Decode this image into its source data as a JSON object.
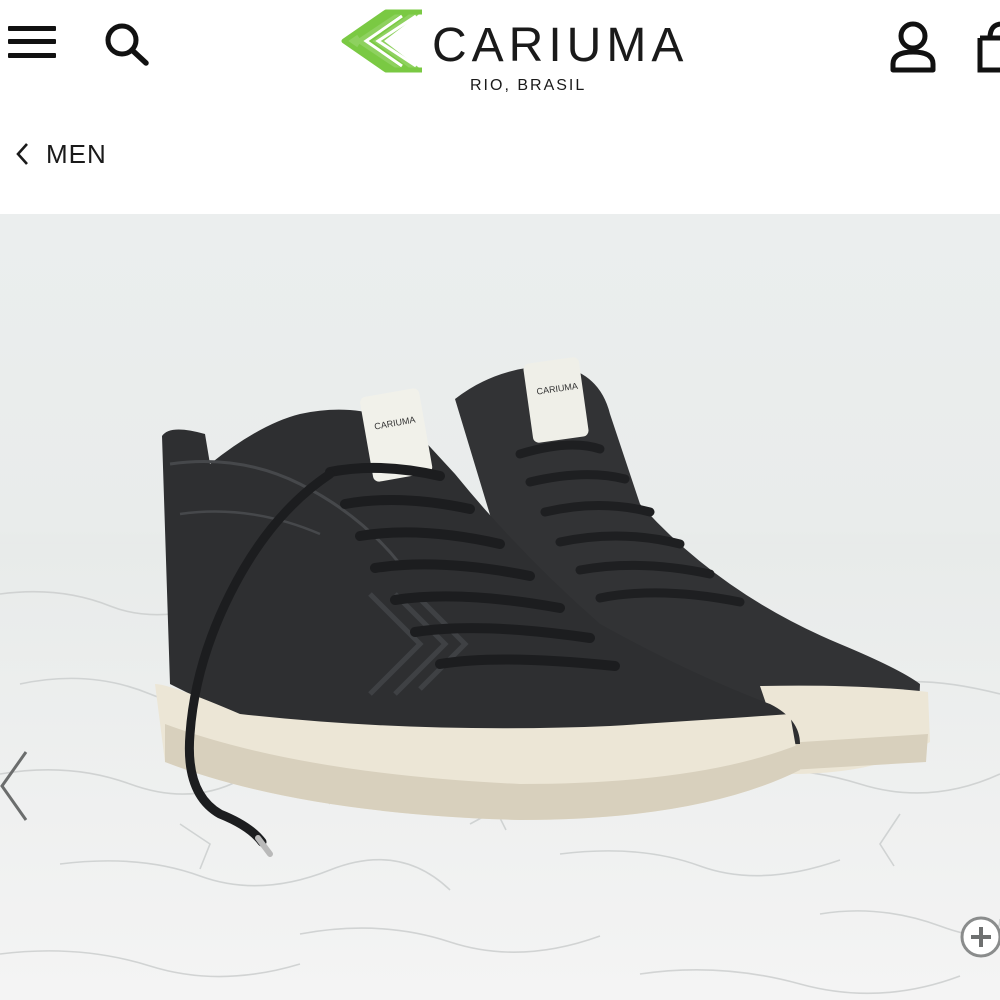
{
  "header": {
    "menu_icon": "hamburger-menu-icon",
    "search_icon": "search-icon",
    "brand": {
      "name": "CARIUMA",
      "subtitle": "RIO, BRASIL",
      "logo_color": "#7ac943"
    },
    "account_icon": "user-icon",
    "cart_icon": "shopping-bag-icon"
  },
  "breadcrumb": {
    "back_icon": "chevron-left-icon",
    "label": "MEN"
  },
  "gallery": {
    "product_image": "black-leather-high-top-sneakers",
    "prev_icon": "chevron-left-icon",
    "zoom_icon": "zoom-in-icon"
  },
  "colors": {
    "text": "#1a1a1a",
    "accent_green": "#7ac943",
    "shoe_leather": "#2e2f31",
    "sole": "#ece6d6"
  }
}
